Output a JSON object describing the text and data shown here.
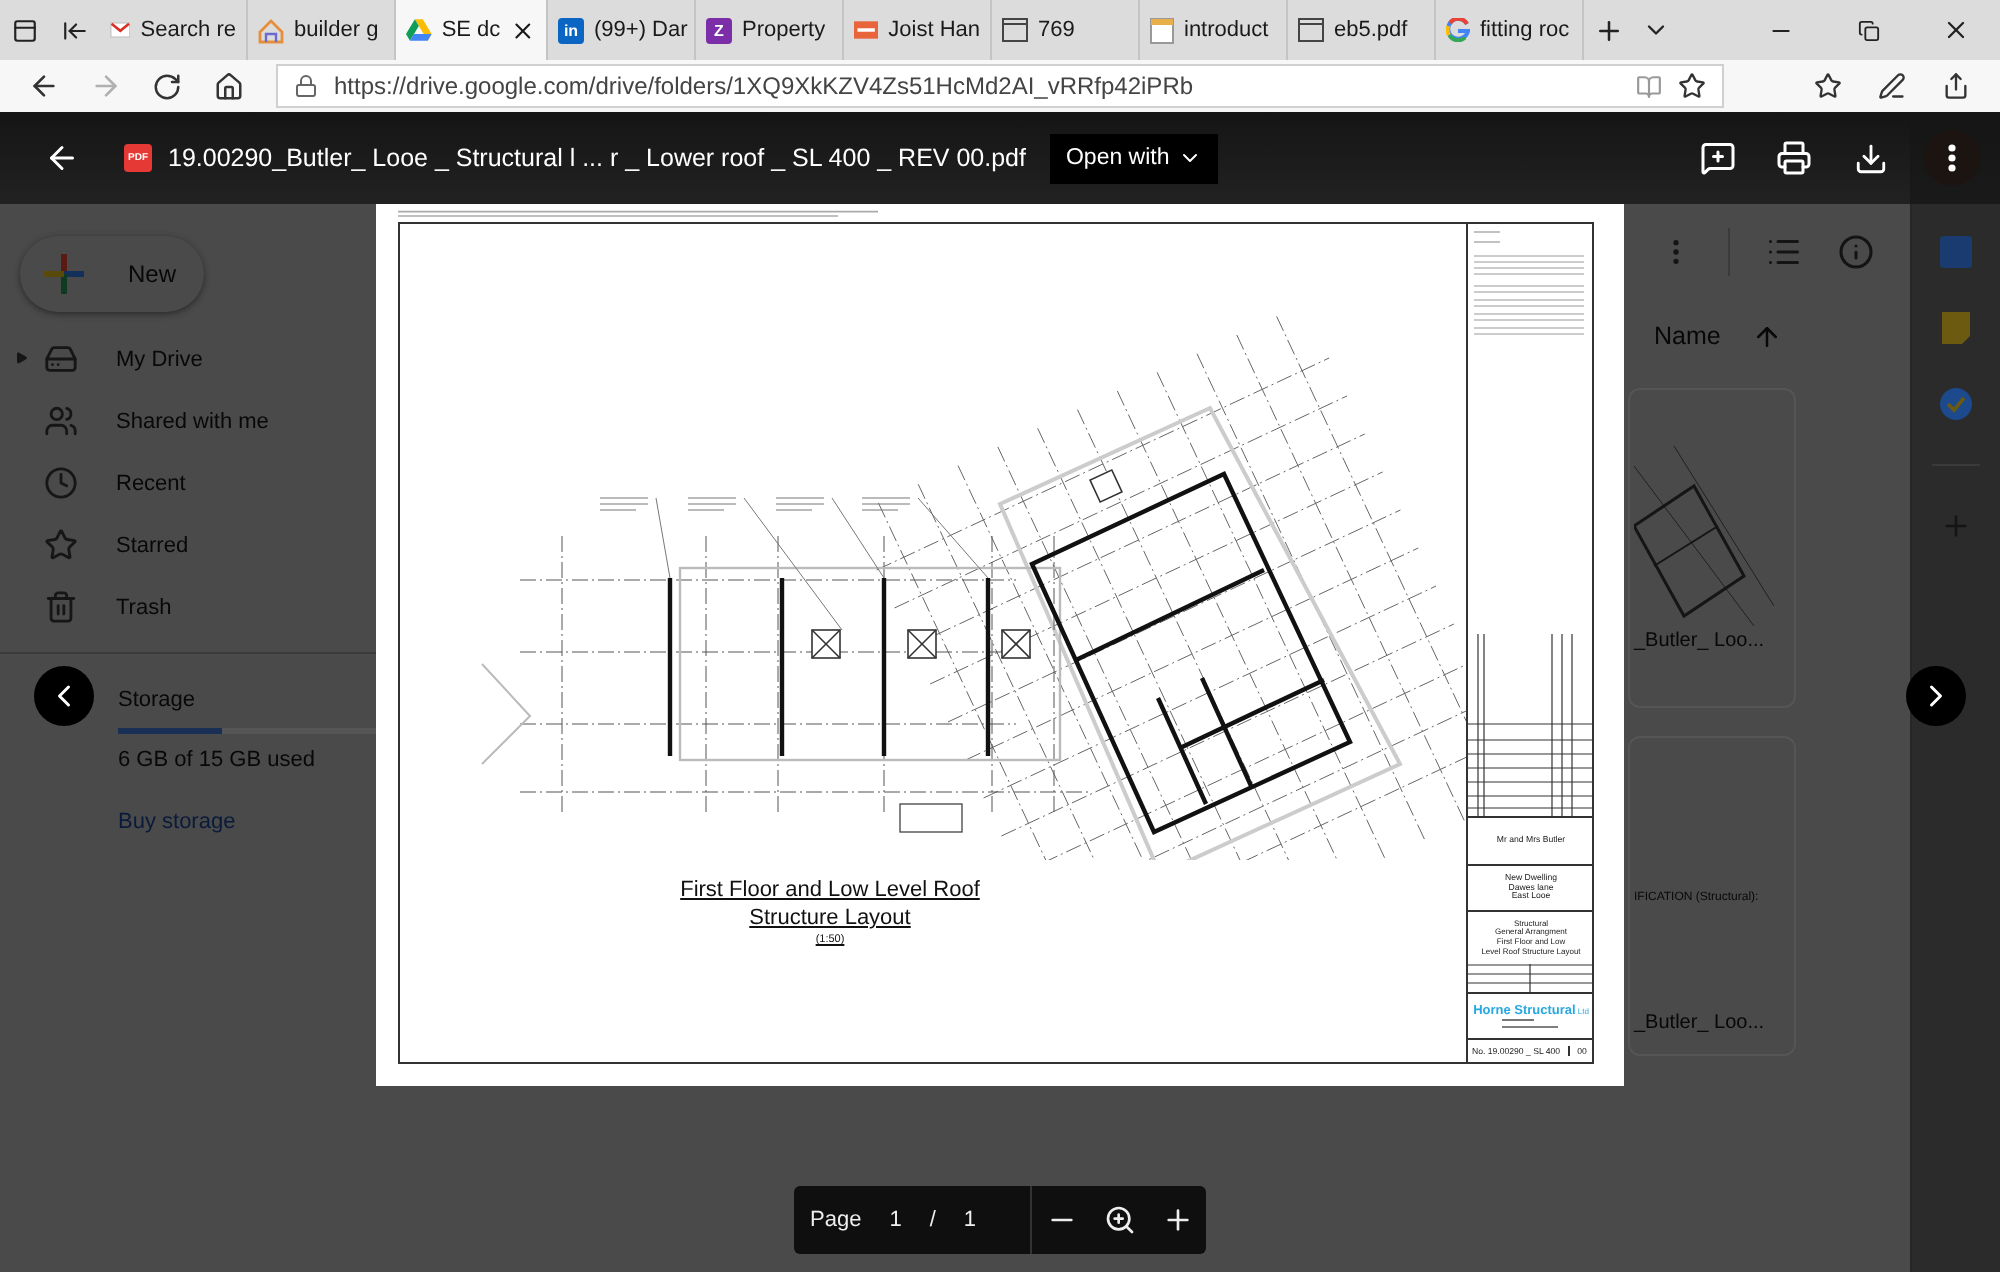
{
  "browser": {
    "tabs": [
      {
        "label": "Search re",
        "kind": "mail",
        "selected": false
      },
      {
        "label": "builder g",
        "kind": "house",
        "selected": false
      },
      {
        "label": "SE dc",
        "kind": "triangle",
        "selected": true
      },
      {
        "label": "(99+) Dar",
        "kind": "letter",
        "icon_text": "in",
        "color": "#0a66c2",
        "selected": false
      },
      {
        "label": "Property",
        "kind": "letter",
        "icon_text": "Z",
        "color": "#7b2ea8",
        "selected": false
      },
      {
        "label": "Joist Han",
        "kind": "strip",
        "selected": false
      },
      {
        "label": "769",
        "kind": "page",
        "selected": false
      },
      {
        "label": "introduct",
        "kind": "note",
        "selected": false
      },
      {
        "label": "eb5.pdf",
        "kind": "page",
        "selected": false
      },
      {
        "label": "fitting roc",
        "kind": "g",
        "selected": false
      }
    ],
    "url": "https://drive.google.com/drive/folders/1XQ9XkKZV4Zs51HcMd2AI_vRRfp42iPRb",
    "forward_disabled": true
  },
  "drive": {
    "new_button": "New",
    "nav": [
      {
        "label": "My Drive",
        "kind": "drive",
        "expandable": true
      },
      {
        "label": "Shared with me",
        "kind": "shared",
        "expandable": false
      },
      {
        "label": "Recent",
        "kind": "recent",
        "expandable": false
      },
      {
        "label": "Starred",
        "kind": "starred",
        "expandable": false
      },
      {
        "label": "Trash",
        "kind": "trash",
        "expandable": false
      }
    ],
    "storage": {
      "label": "Storage",
      "level": 0.4,
      "used": "6 GB of 15 GB used",
      "buy": "Buy storage"
    },
    "sort": {
      "label": "Name"
    },
    "files": [
      {
        "name": "_Butler_ Loo...",
        "kind": "plan"
      },
      {
        "name": "_Butler_ Loo...",
        "kind": "spec",
        "detail": "IFICATION (Structural):"
      }
    ]
  },
  "viewer": {
    "file_badge": "PDF",
    "file_name": "19.00290_Butler_ Looe _ Structural l ... r _ Lower roof _ SL 400 _ REV 00.pdf",
    "open_with": "Open with",
    "drawing": {
      "title_lines": [
        "First Floor and Low Level Roof",
        "Structure  Layout"
      ],
      "scale": "(1:50)",
      "title_block": {
        "client": "Mr and Mrs Butler",
        "project": [
          "New Dwelling",
          "Dawes lane",
          "East Looe"
        ],
        "title": [
          "Structural",
          "General Arrangment",
          "First Floor and Low",
          "Level Roof Structure Layout"
        ],
        "company": "Horne Structural",
        "company_suffix": "Ltd",
        "drawing_no": "No. 19.00290 _ SL 400",
        "revision": "00"
      }
    },
    "pager": {
      "label": "Page",
      "current": "1",
      "separator": "/",
      "total": "1"
    }
  }
}
